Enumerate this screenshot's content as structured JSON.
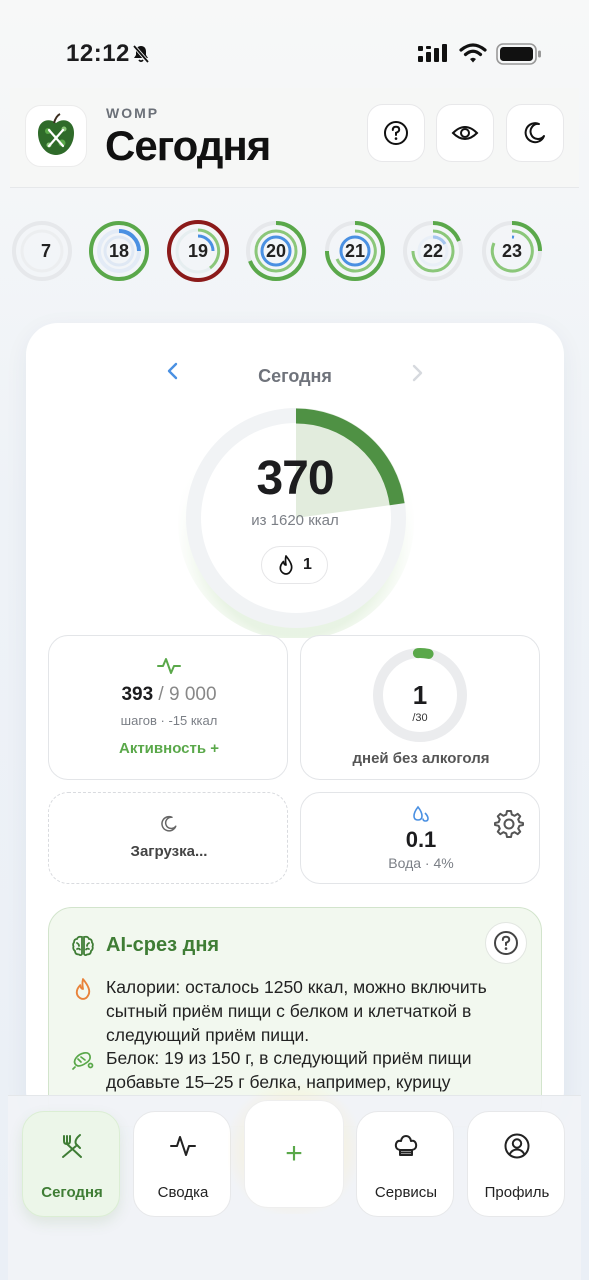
{
  "status_bar": {
    "time": "12:12"
  },
  "header": {
    "brand": "WOMP",
    "title": "Сегодня"
  },
  "day_strip": [
    "7",
    "18",
    "19",
    "20",
    "21",
    "22",
    "23"
  ],
  "date_nav": {
    "label": "Сегодня"
  },
  "calories": {
    "value": "370",
    "subtitle": "из 1620 ккал",
    "goal": 1620,
    "eaten": 370,
    "streak": "1"
  },
  "steps": {
    "count": "393",
    "goal": " / 9 000",
    "subtitle": "шагов · -15 ккал",
    "link": "Активность +"
  },
  "alcohol": {
    "days": "1",
    "of": "/30",
    "label": "дней без алкоголя",
    "progress": 0.033
  },
  "sleep": {
    "label": "Загрузка..."
  },
  "water": {
    "value": "0.1",
    "subtitle": "Вода · 4%"
  },
  "ai_summary": {
    "title": "AI-срез дня",
    "lines": [
      "Калории: осталось 1250 ккал, можно включить сытный приём пищи с белком и клетчаткой в следующий приём пищи.",
      "Белок: 19 из 150 г, в следующий приём пищи добавьте 15–25 г белка, например, курицу"
    ]
  },
  "tabs": {
    "today": "Сегодня",
    "summary": "Сводка",
    "add": "+",
    "services": "Сервисы",
    "profile": "Профиль"
  },
  "colors": {
    "accent": "#5aa84a",
    "accent_dark": "#3f7d35",
    "blue": "#4a90e2",
    "red_ring": "#8b1a1a"
  }
}
